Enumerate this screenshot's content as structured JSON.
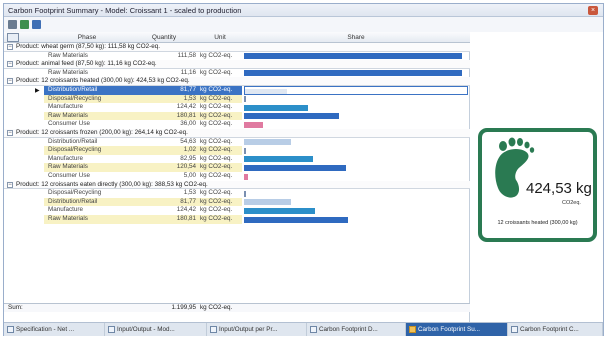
{
  "window": {
    "title": "Carbon Footprint Summary - Model: Croissant 1 - scaled to production"
  },
  "toolbar": {
    "icons": [
      "print-icon",
      "export-excel-icon",
      "chart-icon"
    ]
  },
  "columns": {
    "phase": "Phase",
    "quantity": "Quantity",
    "unit": "Unit",
    "share": "Share"
  },
  "groups": [
    {
      "label": "Product: wheat germ (87,50 kg): 111,58 kg CO2-eq.",
      "rows": [
        {
          "phase": "Raw Materials",
          "qty": "111,58",
          "unit": "kg CO2-eq.",
          "share": 0.98,
          "color": "#2f6ac0",
          "bg": "#ffffff"
        }
      ]
    },
    {
      "label": "Product: animal feed (87,50 kg): 11,16 kg CO2-eq.",
      "rows": [
        {
          "phase": "Raw Materials",
          "qty": "11,16",
          "unit": "kg CO2-eq.",
          "share": 0.98,
          "color": "#2f6ac0",
          "bg": "#ffffff"
        }
      ]
    },
    {
      "label": "Product: 12 croissants heated (300,00 kg): 424,53 kg CO2-eq.",
      "rows": [
        {
          "phase": "Distribution/Retail",
          "qty": "81,77",
          "unit": "kg CO2-eq.",
          "share": 0.19,
          "color": "#dfe7f2",
          "bg": "#3b73c4",
          "selected": true
        },
        {
          "phase": "Disposal/Recycling",
          "qty": "1,53",
          "unit": "kg CO2-eq.",
          "share": 0.005,
          "color": "#7a8fb0",
          "bg": "#f8f2c4"
        },
        {
          "phase": "Manufacture",
          "qty": "124,42",
          "unit": "kg CO2-eq.",
          "share": 0.29,
          "color": "#2c8fc9",
          "bg": "#ffffff"
        },
        {
          "phase": "Raw Materials",
          "qty": "180,81",
          "unit": "kg CO2-eq.",
          "share": 0.43,
          "color": "#2f6ac0",
          "bg": "#f8f2c4"
        },
        {
          "phase": "Consumer Use",
          "qty": "36,00",
          "unit": "kg CO2-eq.",
          "share": 0.085,
          "color": "#e07aa0",
          "bg": "#ffffff"
        }
      ]
    },
    {
      "label": "Product: 12 croissants frozen (200,00 kg): 264,14 kg CO2-eq.",
      "rows": [
        {
          "phase": "Distribution/Retail",
          "qty": "54,63",
          "unit": "kg CO2-eq.",
          "share": 0.21,
          "color": "#b8cde6",
          "bg": "#ffffff"
        },
        {
          "phase": "Disposal/Recycling",
          "qty": "1,02",
          "unit": "kg CO2-eq.",
          "share": 0.005,
          "color": "#7a8fb0",
          "bg": "#f8f2c4"
        },
        {
          "phase": "Manufacture",
          "qty": "82,95",
          "unit": "kg CO2-eq.",
          "share": 0.31,
          "color": "#2c8fc9",
          "bg": "#ffffff"
        },
        {
          "phase": "Raw Materials",
          "qty": "120,54",
          "unit": "kg CO2-eq.",
          "share": 0.46,
          "color": "#2f6ac0",
          "bg": "#f8f2c4"
        },
        {
          "phase": "Consumer Use",
          "qty": "5,00",
          "unit": "kg CO2-eq.",
          "share": 0.02,
          "color": "#e07aa0",
          "bg": "#ffffff"
        }
      ]
    },
    {
      "label": "Product: 12 croissants eaten directly (300,00 kg): 388,53 kg CO2-eq.",
      "rows": [
        {
          "phase": "Disposal/Recycling",
          "qty": "1,53",
          "unit": "kg CO2-eq.",
          "share": 0.005,
          "color": "#7a8fb0",
          "bg": "#ffffff"
        },
        {
          "phase": "Distribution/Retail",
          "qty": "81,77",
          "unit": "kg CO2-eq.",
          "share": 0.21,
          "color": "#b8cde6",
          "bg": "#f8f2c4"
        },
        {
          "phase": "Manufacture",
          "qty": "124,42",
          "unit": "kg CO2-eq.",
          "share": 0.32,
          "color": "#2c8fc9",
          "bg": "#ffffff"
        },
        {
          "phase": "Raw Materials",
          "qty": "180,81",
          "unit": "kg CO2-eq.",
          "share": 0.47,
          "color": "#2f6ac0",
          "bg": "#f8f2c4"
        }
      ]
    }
  ],
  "sum": {
    "label": "Sum:",
    "qty": "1.199,95",
    "unit": "kg CO2-eq."
  },
  "badge": {
    "value": "424,53 kg",
    "unit": "CO2eq.",
    "caption": "12 croissants heated (300,00 kg)",
    "color": "#2a7a52"
  },
  "tabs": [
    {
      "label": "Specification - Net ...",
      "icon": "document-icon"
    },
    {
      "label": "Input/Output - Mod...",
      "icon": "table-icon"
    },
    {
      "label": "Input/Output per Pr...",
      "icon": "table-icon"
    },
    {
      "label": "Carbon Footprint D...",
      "icon": "chart-icon"
    },
    {
      "label": "Carbon Footprint Su...",
      "icon": "chart-icon",
      "active": true
    },
    {
      "label": "Carbon Footprint C...",
      "icon": "chart-icon"
    }
  ]
}
